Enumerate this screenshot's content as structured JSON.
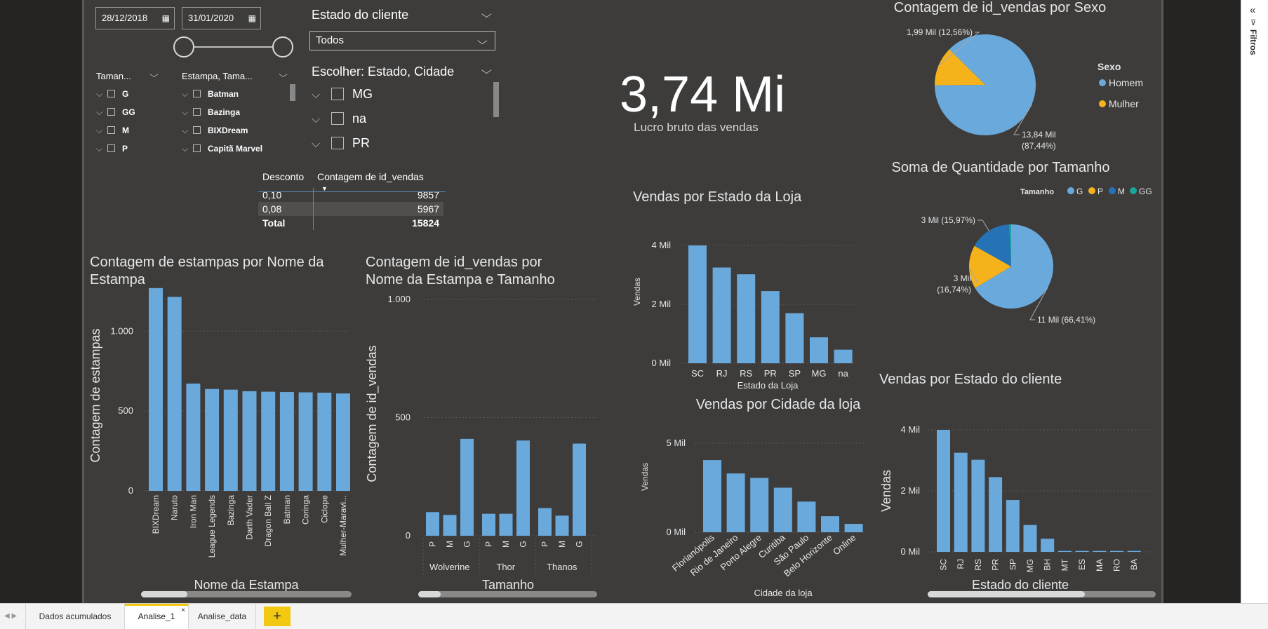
{
  "colors": {
    "bar": "#6aa9dc",
    "homem": "#6aa9dc",
    "mulher": "#f5b21b",
    "size_g": "#6aa9dc",
    "size_p": "#f5b21b",
    "size_m": "#2672b7",
    "size_gg": "#1aa49d",
    "text": "#e6e6e6",
    "grid": "#5a5958"
  },
  "date_slicer": {
    "start": "28/12/2018",
    "end": "31/01/2020"
  },
  "estado_cliente_slicer": {
    "title": "Estado do cliente",
    "value": "Todos"
  },
  "tamanho_slicer": {
    "title": "Taman...",
    "items": [
      "G",
      "GG",
      "M",
      "P"
    ]
  },
  "estampa_slicer": {
    "title": "Estampa, Tama...",
    "items": [
      "Batman",
      "Bazinga",
      "BIXDream",
      "Capitã Marvel"
    ]
  },
  "estado_cidade_slicer": {
    "title": "Escolher: Estado, Cidade",
    "items": [
      "MG",
      "na",
      "PR"
    ]
  },
  "kpi": {
    "value": "3,74 Mi",
    "label": "Lucro bruto das vendas"
  },
  "desconto_table": {
    "headers": [
      "Desconto",
      "Contagem de id_vendas"
    ],
    "rows": [
      [
        "0,10",
        "9857"
      ],
      [
        "0,08",
        "5967"
      ]
    ],
    "total": [
      "Total",
      "15824"
    ]
  },
  "chart_data": [
    {
      "id": "estampas",
      "type": "bar",
      "title": "Contagem de estampas por Nome da Estampa",
      "title_lines": [
        "Contagem de estampas por Nome da",
        "Estampa"
      ],
      "xlabel": "Nome da Estampa",
      "ylabel": "Contagem de estampas",
      "categories": [
        "BIXDream",
        "Naruto",
        "Iron Man",
        "League Legends",
        "Bazinga",
        "Darth Vader",
        "Dragon Ball Z",
        "Batman",
        "Coringa",
        "Ciclope",
        "Mulher-Maravi..."
      ],
      "values": [
        1270,
        1215,
        672,
        638,
        634,
        624,
        621,
        619,
        617,
        615,
        610
      ],
      "yticks": [
        "0",
        "500",
        "1.000"
      ],
      "ytick_values": [
        0,
        500,
        1000
      ],
      "ylim": [
        0,
        1300
      ]
    },
    {
      "id": "estampa_tamanho",
      "type": "bar",
      "title": "Contagem de id_vendas por Nome da Estampa e Tamanho",
      "title_lines": [
        "Contagem de id_vendas por",
        "Nome da Estampa e Tamanho"
      ],
      "xlabel": "Tamanho",
      "ylabel": "Contagem de id_vendas",
      "groups": [
        {
          "name": "Wolverine",
          "categories": [
            "P",
            "M",
            "G"
          ],
          "values": [
            100,
            88,
            410
          ]
        },
        {
          "name": "Thor",
          "categories": [
            "P",
            "M",
            "G"
          ],
          "values": [
            93,
            93,
            403
          ]
        },
        {
          "name": "Thanos",
          "categories": [
            "P",
            "M",
            "G"
          ],
          "values": [
            117,
            85,
            390
          ]
        }
      ],
      "yticks": [
        "0",
        "500",
        "1.000"
      ],
      "ytick_values": [
        0,
        500,
        1000
      ],
      "ylim": [
        0,
        1000
      ]
    },
    {
      "id": "estado_loja",
      "type": "bar",
      "title": "Vendas por Estado da Loja",
      "xlabel": "Estado da Loja",
      "ylabel": "Vendas",
      "categories": [
        "SC",
        "RJ",
        "RS",
        "PR",
        "SP",
        "MG",
        "na"
      ],
      "values": [
        4000,
        3250,
        3020,
        2450,
        1700,
        880,
        460
      ],
      "yticks": [
        "0 Mil",
        "2 Mil",
        "4 Mil"
      ],
      "ytick_values": [
        0,
        2000,
        4000
      ],
      "ylim": [
        0,
        4000
      ]
    },
    {
      "id": "cidade_loja",
      "type": "bar",
      "title": "Vendas por Cidade da loja",
      "xlabel": "Cidade da loja",
      "ylabel": "Vendas",
      "categories": [
        "Florianópolis",
        "Rio de Janeiro",
        "Porto Alegre",
        "Curitiba",
        "São Paulo",
        "Belo Horizonte",
        "Online"
      ],
      "values": [
        4050,
        3300,
        3050,
        2500,
        1720,
        900,
        470
      ],
      "yticks": [
        "0 Mil",
        "5 Mil"
      ],
      "ytick_values": [
        0,
        5000
      ],
      "ylim": [
        0,
        5000
      ]
    },
    {
      "id": "estado_cliente",
      "type": "bar",
      "title": "Vendas por Estado do cliente",
      "xlabel": "Estado do cliente",
      "ylabel": "Vendas",
      "categories": [
        "SC",
        "RJ",
        "RS",
        "PR",
        "SP",
        "MG",
        "BH",
        "MT",
        "ES",
        "MA",
        "RO",
        "BA"
      ],
      "values": [
        4000,
        3250,
        3020,
        2450,
        1700,
        880,
        430,
        30,
        30,
        30,
        30,
        30
      ],
      "yticks": [
        "0 Mil",
        "2 Mil",
        "4 Mil"
      ],
      "ytick_values": [
        0,
        2000,
        4000
      ],
      "ylim": [
        0,
        4000
      ]
    },
    {
      "id": "sexo",
      "type": "pie",
      "title": "Contagem de id_vendas por Sexo",
      "legend_title": "Sexo",
      "slices": [
        {
          "name": "Homem",
          "value": 13.84,
          "label": "13,84 Mil (87,44%)",
          "label_lines": [
            "13,84 Mil",
            "(87,44%)"
          ]
        },
        {
          "name": "Mulher",
          "value": 1.99,
          "label": "1,99 Mil (12,56%)",
          "label_lines": [
            "1,99 Mil (12,56%)"
          ]
        }
      ]
    },
    {
      "id": "tamanho",
      "type": "pie",
      "title": "Soma de Quantidade por Tamanho",
      "legend_title": "Tamanho",
      "slices": [
        {
          "name": "G",
          "value": 66.41,
          "label": "11 Mil (66,41%)",
          "label_lines": [
            "11 Mil (66,41%)"
          ]
        },
        {
          "name": "P",
          "value": 16.74,
          "label": "3 Mil (16,74%)",
          "label_lines": [
            "3 Mil",
            "(16,74%)"
          ]
        },
        {
          "name": "M",
          "value": 15.97,
          "label": "3 Mil (15,97%)",
          "label_lines": [
            "3 Mil (15,97%)"
          ]
        },
        {
          "name": "GG",
          "value": 0.88,
          "label": "",
          "label_lines": []
        }
      ]
    }
  ],
  "filters_pane": {
    "label": "Filtros",
    "collapse_icon": "«"
  },
  "tabs": [
    {
      "label": "Dados acumulados",
      "active": false
    },
    {
      "label": "Analise_1",
      "active": true
    },
    {
      "label": "Analise_data",
      "active": false
    }
  ],
  "add_tab_label": "+"
}
